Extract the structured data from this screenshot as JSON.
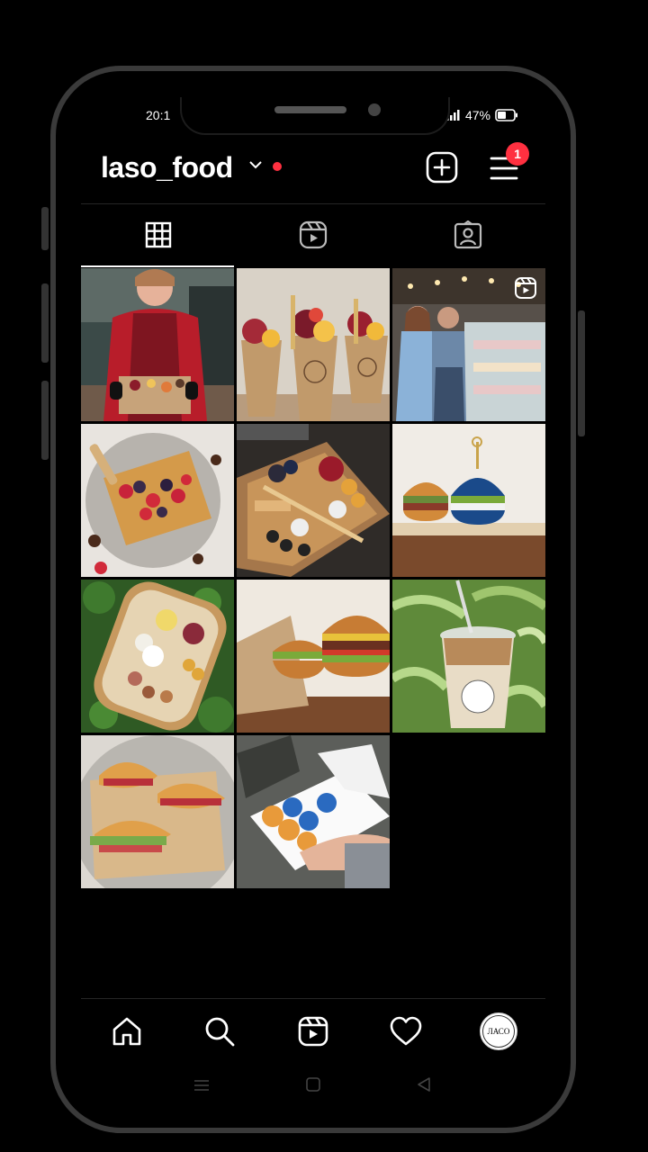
{
  "status": {
    "time": "20:1",
    "battery": "47%"
  },
  "profile": {
    "username": "laso_food",
    "menu_badge": "1"
  },
  "tabs": [
    {
      "name": "grid",
      "icon": "grid-icon",
      "active": true
    },
    {
      "name": "reels",
      "icon": "reels-icon",
      "active": false
    },
    {
      "name": "tagged",
      "icon": "tagged-icon",
      "active": false
    }
  ],
  "posts": [
    {
      "desc": "woman in red apron holding snack box",
      "reel": false
    },
    {
      "desc": "charcuterie cones with fruit",
      "reel": false
    },
    {
      "desc": "couple in front of pastry counter",
      "reel": true
    },
    {
      "desc": "waffle with berries",
      "reel": false
    },
    {
      "desc": "snack box with bread sticks",
      "reel": false
    },
    {
      "desc": "mini burgers on wood",
      "reel": false
    },
    {
      "desc": "snack box on grass",
      "reel": false
    },
    {
      "desc": "burgers on board",
      "reel": false
    },
    {
      "desc": "iced coffee cup",
      "reel": false
    },
    {
      "desc": "croissant sandwiches",
      "reel": false
    },
    {
      "desc": "donut box in hands",
      "reel": false
    }
  ],
  "avatar_text": "ЛАСО",
  "colors": {
    "accent": "#ff3040",
    "background": "#000000",
    "divider": "#262626"
  }
}
